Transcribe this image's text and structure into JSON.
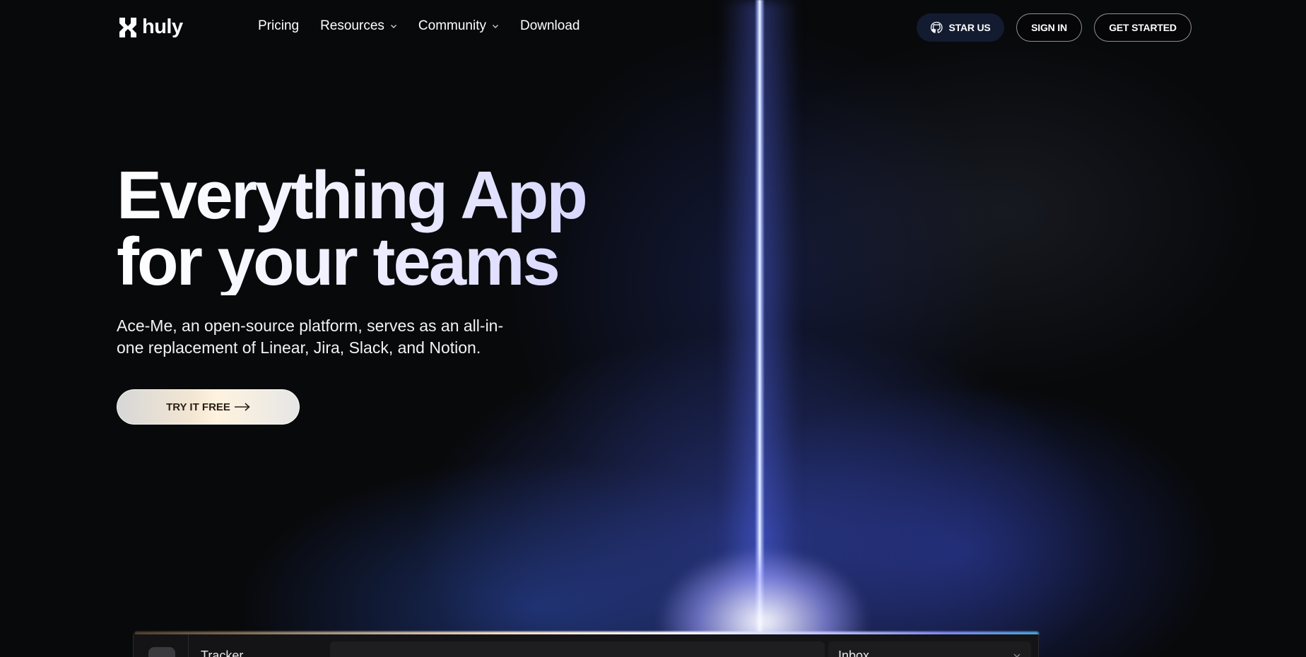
{
  "brand": {
    "name": "huly"
  },
  "nav": {
    "items": [
      {
        "label": "Pricing",
        "dropdown": false
      },
      {
        "label": "Resources",
        "dropdown": true
      },
      {
        "label": "Community",
        "dropdown": true
      },
      {
        "label": "Download",
        "dropdown": false
      }
    ]
  },
  "actions": {
    "star_label": "STAR US",
    "signin_label": "SIGN IN",
    "get_started_label": "GET STARTED"
  },
  "hero": {
    "headline_line1": "Everything App",
    "headline_line2": "for your teams",
    "subtitle": "Ace-Me, an open-source platform, serves as an all-in-one replacement of Linear, Jira, Slack, and Notion.",
    "cta_label": "TRY IT FREE"
  },
  "preview": {
    "section_title": "Tracker",
    "inbox_label": "Inbox"
  },
  "colors": {
    "background": "#08090b",
    "beam": "#ffffff",
    "glow": "#4a5cff",
    "star_button_bg": "#131b30",
    "cta_text": "#2a1e15"
  },
  "icons": {
    "logo": "huly-logo-icon",
    "star": "github-icon",
    "cta": "arrow-right-icon",
    "dropdown": "chevron-down-icon"
  }
}
